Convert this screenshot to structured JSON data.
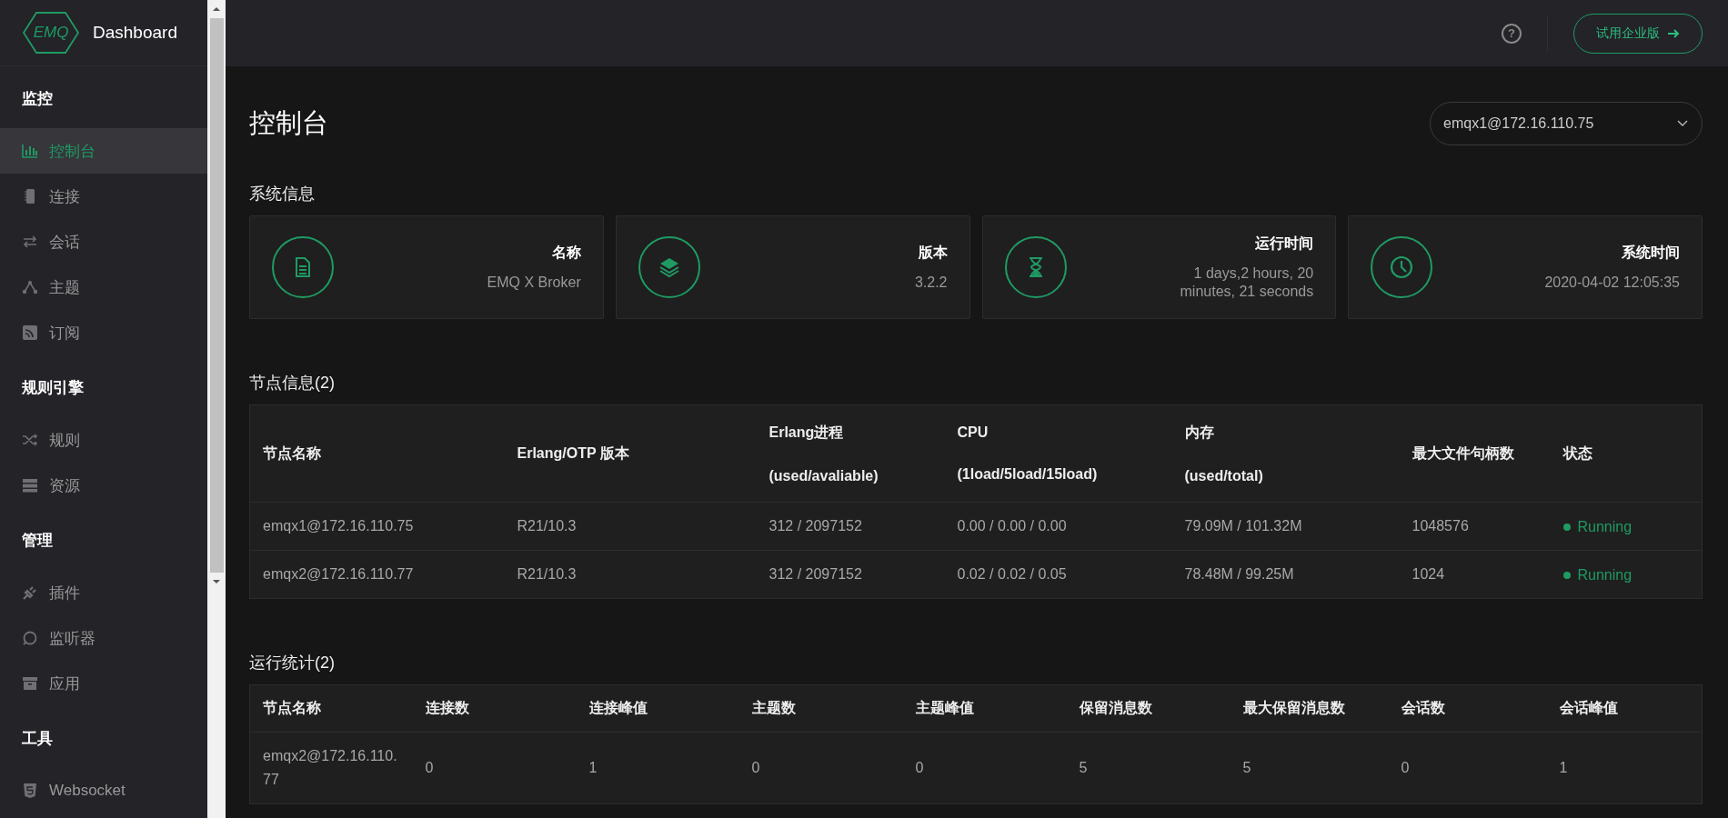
{
  "sidebar": {
    "logo": "EMQ",
    "title": "Dashboard",
    "groups": [
      {
        "title": "监控",
        "items": [
          {
            "label": "控制台",
            "selected": true
          },
          {
            "label": "连接",
            "selected": false
          },
          {
            "label": "会话",
            "selected": false
          },
          {
            "label": "主题",
            "selected": false
          },
          {
            "label": "订阅",
            "selected": false
          }
        ]
      },
      {
        "title": "规则引擎",
        "items": [
          {
            "label": "规则",
            "selected": false
          },
          {
            "label": "资源",
            "selected": false
          }
        ]
      },
      {
        "title": "管理",
        "items": [
          {
            "label": "插件",
            "selected": false
          },
          {
            "label": "监听器",
            "selected": false
          },
          {
            "label": "应用",
            "selected": false
          }
        ]
      },
      {
        "title": "工具",
        "items": [
          {
            "label": "Websocket",
            "selected": false
          }
        ]
      }
    ]
  },
  "header": {
    "help": "?",
    "trial_button": "试用企业版"
  },
  "page_title": "控制台",
  "node_select": {
    "value": "emqx1@172.16.110.75"
  },
  "system_info": {
    "title": "系统信息",
    "cards": [
      {
        "title": "名称",
        "value": "EMQ X Broker"
      },
      {
        "title": "版本",
        "value": "3.2.2"
      },
      {
        "title": "运行时间",
        "value": "1 days,2 hours, 20 minutes, 21 seconds"
      },
      {
        "title": "系统时间",
        "value": "2020-04-02 12:05:35"
      }
    ]
  },
  "nodes": {
    "title": "节点信息(2)",
    "columns": [
      {
        "label": "节点名称"
      },
      {
        "label": "Erlang/OTP 版本"
      },
      {
        "label": "Erlang进程",
        "unit": "(used/avaliable)"
      },
      {
        "label": "CPU",
        "unit": "(1load/5load/15load)"
      },
      {
        "label": "内存",
        "unit": "(used/total)"
      },
      {
        "label": "最大文件句柄数"
      },
      {
        "label": "状态"
      }
    ],
    "rows": [
      {
        "cells": [
          "emqx1@172.16.110.75",
          "R21/10.3",
          "312 / 2097152",
          "0.00 / 0.00 / 0.00",
          "79.09M / 101.32M",
          "1048576"
        ],
        "status": "Running"
      },
      {
        "cells": [
          "emqx2@172.16.110.77",
          "R21/10.3",
          "312 / 2097152",
          "0.02 / 0.02 / 0.05",
          "78.48M / 99.25M",
          "1024"
        ],
        "status": "Running"
      }
    ]
  },
  "stats": {
    "title": "运行统计(2)",
    "columns": [
      "节点名称",
      "连接数",
      "连接峰值",
      "主题数",
      "主题峰值",
      "保留消息数",
      "最大保留消息数",
      "会话数",
      "会话峰值"
    ],
    "rows": [
      [
        "emqx2@172.16.110.77",
        "0",
        "1",
        "0",
        "0",
        "5",
        "5",
        "0",
        "1"
      ]
    ]
  }
}
